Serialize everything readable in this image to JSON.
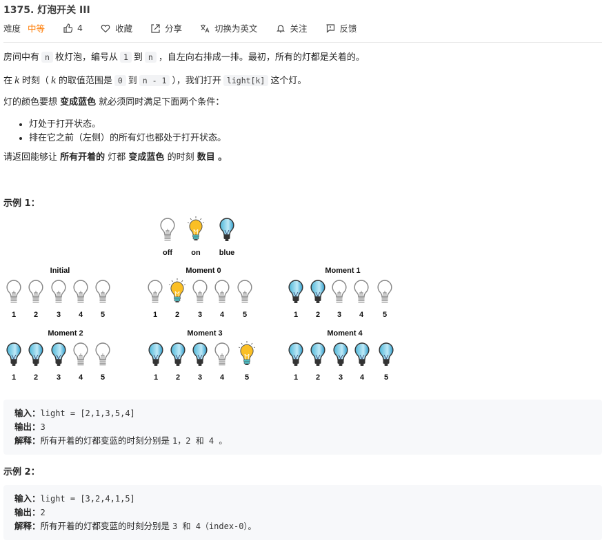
{
  "header": {
    "title": "1375. 灯泡开关 III",
    "difficulty_label": "难度",
    "difficulty": "中等",
    "difficulty_color": "#ff7a00",
    "actions": [
      {
        "icon": "thumbs-up-icon",
        "label": "4"
      },
      {
        "icon": "heart-icon",
        "label": "收藏"
      },
      {
        "icon": "share-icon",
        "label": "分享"
      },
      {
        "icon": "translate-icon",
        "label": "切换为英文"
      },
      {
        "icon": "bell-icon",
        "label": "关注"
      },
      {
        "icon": "feedback-icon",
        "label": "反馈"
      }
    ]
  },
  "description": {
    "paragraphs": [
      [
        {
          "t": "房间中有"
        },
        {
          "t": "n",
          "c": 1
        },
        {
          "t": "枚灯泡，编号从"
        },
        {
          "t": "1",
          "c": 1
        },
        {
          "t": "到"
        },
        {
          "t": "n",
          "c": 1
        },
        {
          "t": "，自左向右排成一排。最初，所有的灯都是关着的。"
        }
      ],
      [
        {
          "t": "在"
        },
        {
          "t": "k",
          "i": 1
        },
        {
          "t": "时刻（"
        },
        {
          "t": "k",
          "i": 1
        },
        {
          "t": "的取值范围是"
        },
        {
          "t": "0",
          "c": 1
        },
        {
          "t": "到"
        },
        {
          "t": "n - 1",
          "c": 1
        },
        {
          "t": "），我们打开"
        },
        {
          "t": "light[k]",
          "c": 1
        },
        {
          "t": "这个灯。"
        }
      ],
      [
        {
          "t": "灯的颜色要想 "
        },
        {
          "t": "变成蓝色",
          "b": 1
        },
        {
          "t": " 就必须同时满足下面两个条件："
        }
      ]
    ],
    "bullets": [
      "灯处于打开状态。",
      "排在它之前（左侧）的所有灯也都处于打开状态。"
    ],
    "closing": [
      {
        "t": "请返回能够让 "
      },
      {
        "t": "所有开着的",
        "b": 1
      },
      {
        "t": " 灯都 "
      },
      {
        "t": "变成蓝色",
        "b": 1
      },
      {
        "t": " 的时刻 "
      },
      {
        "t": "数目 。",
        "b": 1
      }
    ]
  },
  "figure": {
    "legend": [
      {
        "state": "off",
        "label": "off"
      },
      {
        "state": "on",
        "label": "on"
      },
      {
        "state": "blue",
        "label": "blue"
      }
    ],
    "groups": [
      {
        "title": "Initial",
        "states": [
          "off",
          "off",
          "off",
          "off",
          "off"
        ]
      },
      {
        "title": "Moment 0",
        "states": [
          "off",
          "on",
          "off",
          "off",
          "off"
        ]
      },
      {
        "title": "Moment 1",
        "states": [
          "blue",
          "blue",
          "off",
          "off",
          "off"
        ]
      },
      {
        "title": "Moment 2",
        "states": [
          "blue",
          "blue",
          "blue",
          "off",
          "off"
        ]
      },
      {
        "title": "Moment 3",
        "states": [
          "blue",
          "blue",
          "blue",
          "off",
          "on"
        ]
      },
      {
        "title": "Moment 4",
        "states": [
          "blue",
          "blue",
          "blue",
          "blue",
          "blue"
        ]
      }
    ],
    "numbers": [
      "1",
      "2",
      "3",
      "4",
      "5"
    ]
  },
  "examples": [
    {
      "heading": "示例 1：",
      "input_label": "输入：",
      "input": "light = [2,1,3,5,4]",
      "output_label": "输出：",
      "output": "3",
      "explain_label": "解释：",
      "explain_text": "所有开着的灯都变蓝的时刻分别是",
      "explain_code": "1，2 和 4 。"
    },
    {
      "heading": "示例 2：",
      "input_label": "输入：",
      "input": "light = [3,2,4,1,5]",
      "output_label": "输出：",
      "output": "2",
      "explain_label": "解释：",
      "explain_text": "所有开着的灯都变蓝的时刻分别是",
      "explain_code": "3 和 4（index-0）。"
    }
  ]
}
